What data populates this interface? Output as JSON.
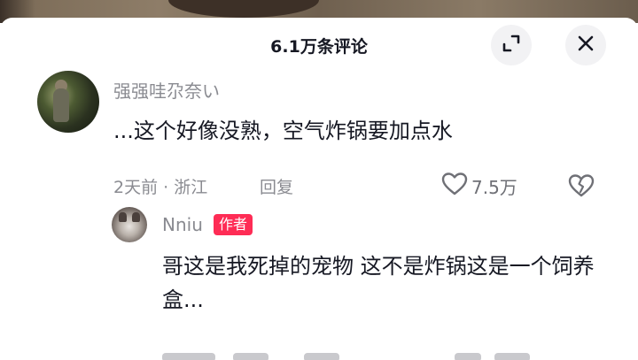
{
  "header": {
    "title": "6.1万条评论"
  },
  "icons": {
    "expand": "expand-icon",
    "close": "close-icon",
    "like": "heart-outline-icon",
    "dislike": "broken-heart-icon"
  },
  "comment": {
    "username": "强强哇尕奈い",
    "text": "...这个好像没熟，空气炸锅要加点水",
    "time_location": "2天前 · 浙江",
    "reply_label": "回复",
    "like_count": "7.5万"
  },
  "reply": {
    "username": "Nniu",
    "badge": "作者",
    "text": "哥这是我死掉的宠物 这不是炸锅这是一个饲养盒..."
  },
  "colors": {
    "accent": "#fe2c55",
    "text": "#161823",
    "muted": "#8a8b91"
  }
}
